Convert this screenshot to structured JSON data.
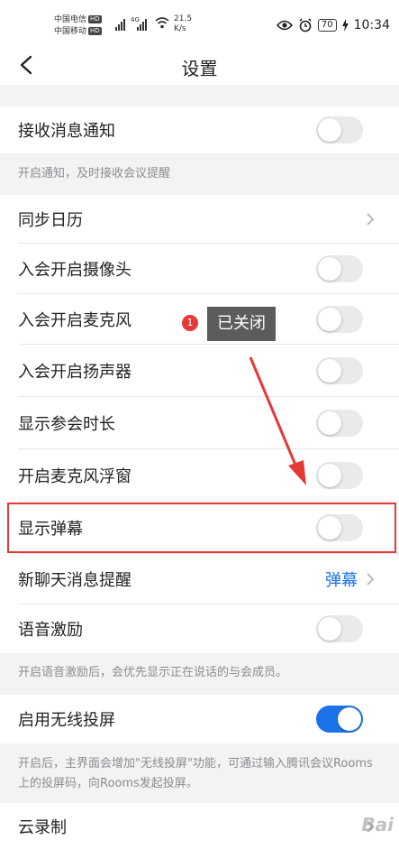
{
  "status_bar": {
    "carrier1": "中国电信",
    "carrier2": "中国移动",
    "hd": "HD",
    "network": "4G",
    "speed": "21.5",
    "speed_unit": "K/s",
    "battery": "70",
    "time": "10:34"
  },
  "nav": {
    "title": "设置"
  },
  "rows": {
    "notify": {
      "label": "接收消息通知",
      "toggle": false
    },
    "notify_hint": "开启通知，及时接收会议提醒",
    "calendar": {
      "label": "同步日历"
    },
    "camera": {
      "label": "入会开启摄像头",
      "toggle": false
    },
    "mic": {
      "label": "入会开启麦克风",
      "toggle": false
    },
    "speaker": {
      "label": "入会开启扬声器",
      "toggle": false
    },
    "duration": {
      "label": "显示参会时长",
      "toggle": false
    },
    "mic_float": {
      "label": "开启麦克风浮窗",
      "toggle": false
    },
    "barrage": {
      "label": "显示弹幕",
      "toggle": false
    },
    "chat": {
      "label": "新聊天消息提醒",
      "value": "弹幕"
    },
    "voice": {
      "label": "语音激励",
      "toggle": false
    },
    "voice_hint": "开启语音激励后，会优先显示正在说话的与会成员。",
    "cast": {
      "label": "启用无线投屏",
      "toggle": true
    },
    "cast_hint": "开启后，主界面会增加\"无线投屏\"功能，可通过输入腾讯会议Rooms上的投屏码，向Rooms发起投屏。",
    "cloud": {
      "label": "云录制"
    }
  },
  "annotation": {
    "badge": "1",
    "tooltip": "已关闭"
  },
  "watermark": "Bai",
  "colors": {
    "accent": "#1a73e8",
    "annotation_red": "#e53935"
  }
}
